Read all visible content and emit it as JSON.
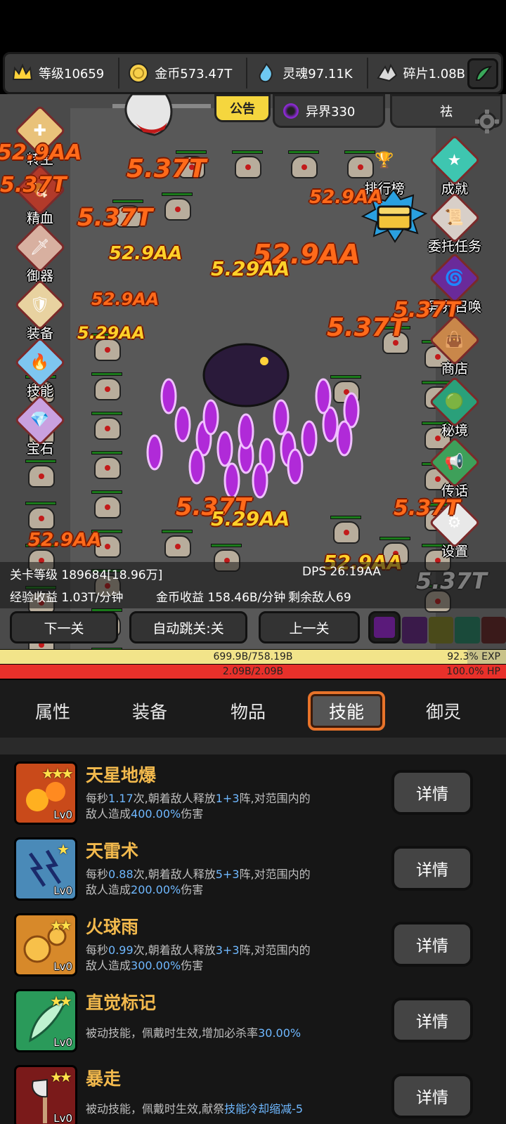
{
  "resources": [
    {
      "icon": "crown-icon",
      "text": "等级10659"
    },
    {
      "icon": "gold-coin-icon",
      "text": "金币573.47T"
    },
    {
      "icon": "soul-flame-icon",
      "text": "灵魂97.11K"
    },
    {
      "icon": "shard-icon",
      "text": "碎片1.08B"
    }
  ],
  "field": {
    "notice_label": "公告",
    "otherworld_label": "异界330",
    "dispel_label": "祛",
    "left_menu": [
      "转生",
      "精血",
      "御器",
      "装备",
      "技能",
      "宝石"
    ],
    "right_menu": [
      "排行榜",
      "成就",
      "委托任务",
      "异界召唤",
      "商店",
      "秘境",
      "传话",
      "设置"
    ],
    "damage_texts": [
      "5.37T",
      "52.9AA",
      "5.29AA",
      "5.37T",
      "52.9AA",
      "5.37T",
      "52.9AA",
      "52.9AA",
      "5.29AA",
      "5.37T",
      "52.9AA",
      "5.37T"
    ]
  },
  "stats": {
    "stage_level": "关卡等级 189684[18.96万]",
    "dps": "DPS 26.19AA",
    "exp_income": "经验收益 1.03T/分钟",
    "gold_income": "金币收益 158.46B/分钟",
    "enemies_left": "剩余敌人69"
  },
  "controls": {
    "next_stage": "下一关",
    "auto_skip": "自动跳关:关",
    "prev_stage": "上一关"
  },
  "exp_bar": {
    "text": "699.9B/758.19B",
    "percent_text": "92.3% EXP",
    "fraction": 0.923
  },
  "hp_bar": {
    "text": "2.09B/2.09B",
    "percent_text": "100.0%  HP",
    "fraction": 1.0
  },
  "tabs": [
    "属性",
    "装备",
    "物品",
    "技能",
    "御灵"
  ],
  "active_tab": "技能",
  "skills": [
    {
      "name": "天星地爆",
      "stars": "★★★",
      "level": "Lv0",
      "line1_a": "每秒",
      "line1_v1": "1.17",
      "line1_b": "次,朝着敌人释放",
      "line1_v2": "1+3",
      "line1_c": "阵,对范围内的",
      "line2_a": "敌人造成",
      "line2_v": "400.00%",
      "line2_b": "伤害",
      "detail": "详情",
      "color": "#c94a1a"
    },
    {
      "name": "天雷术",
      "stars": "★",
      "level": "Lv0",
      "line1_a": "每秒",
      "line1_v1": "0.88",
      "line1_b": "次,朝着敌人释放",
      "line1_v2": "5+3",
      "line1_c": "阵,对范围内的",
      "line2_a": "敌人造成",
      "line2_v": "200.00%",
      "line2_b": "伤害",
      "detail": "详情",
      "color": "#4a8ab8"
    },
    {
      "name": "火球雨",
      "stars": "★★",
      "level": "Lv0",
      "line1_a": "每秒",
      "line1_v1": "0.99",
      "line1_b": "次,朝着敌人释放",
      "line1_v2": "3+3",
      "line1_c": "阵,对范围内的",
      "line2_a": "敌人造成",
      "line2_v": "300.00%",
      "line2_b": "伤害",
      "detail": "详情",
      "color": "#d7892a"
    },
    {
      "name": "直觉标记",
      "stars": "★★",
      "level": "Lv0",
      "line1_a": "被动技能，佩戴时生效,增加必杀率",
      "line1_v1": "30.00%",
      "line1_b": "",
      "line1_v2": "",
      "line1_c": "",
      "line2_a": "",
      "line2_v": "",
      "line2_b": "",
      "detail": "详情",
      "color": "#2a9a5a"
    },
    {
      "name": "暴走",
      "stars": "★★",
      "level": "Lv0",
      "line1_a": "被动技能，佩戴时生效,献祭",
      "line1_v1": "技能冷却缩减-5",
      "line1_b": "",
      "line1_v2": "",
      "line1_c": "",
      "line2_a": "",
      "line2_v": "",
      "line2_b": "",
      "detail": "详情",
      "color": "#7a1a1a"
    }
  ]
}
